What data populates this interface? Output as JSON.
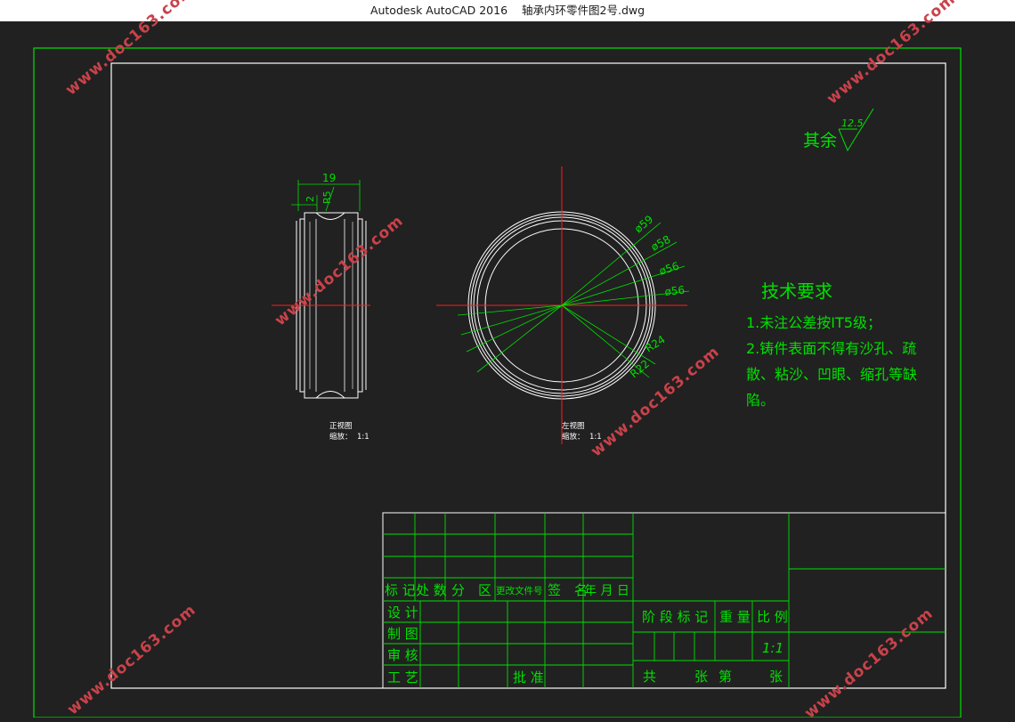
{
  "window": {
    "app_title": "Autodesk AutoCAD 2016",
    "file_name": "轴承内环零件图2号.dwg"
  },
  "colors": {
    "background": "#212121",
    "frame_green": "#00e000",
    "outline_white": "#ffffff",
    "centerline_red": "#ff1a1a",
    "watermark": "#c9424a"
  },
  "drawing": {
    "roughness_label": "其余",
    "roughness_value": "12.5",
    "front_view": {
      "dim_width": "19",
      "dim_small": "2",
      "dim_radius": "R5",
      "caption_line1": "正视图",
      "caption_line2": "缩放：",
      "caption_scale": "1:1"
    },
    "left_view": {
      "dims": [
        "ø59",
        "ø58",
        "ø56",
        "ø56",
        "R24",
        "R22"
      ],
      "caption_line1": "左视图",
      "caption_line2": "缩放：",
      "caption_scale": "1:1"
    },
    "tech_req": {
      "title": "技术要求",
      "line1": "1.未注公差按IT5级；",
      "line2": "2.铸件表面不得有沙孔、疏",
      "line3": "散、粘沙、凹眼、缩孔等缺",
      "line4": "陷。"
    }
  },
  "title_block": {
    "header_cells": [
      "标 记",
      "处 数",
      "分　区",
      "更改文件号",
      "签　名",
      "年 月 日"
    ],
    "row_labels": [
      "设 计",
      "制 图",
      "审 核",
      "工 艺"
    ],
    "approve_label": "批 准",
    "stage_label": "阶 段 标 记",
    "weight_label": "重 量",
    "scale_label": "比 例",
    "scale_value": "1:1",
    "sheet_total": "共",
    "sheet_zhang1": "张",
    "sheet_di": "第",
    "sheet_zhang2": "张"
  },
  "watermark_text": "www.doc163.com"
}
